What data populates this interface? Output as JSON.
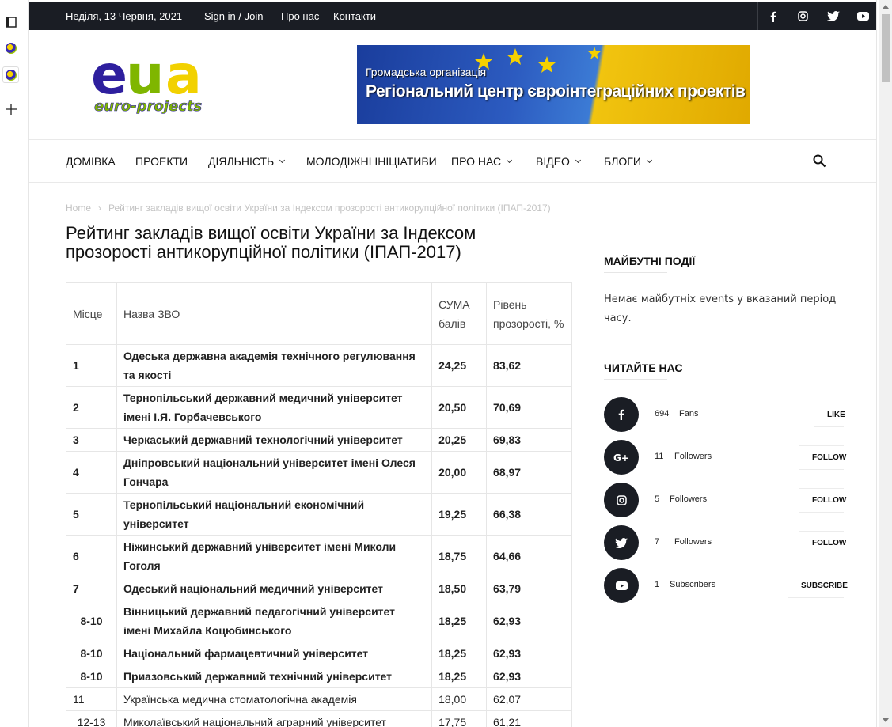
{
  "browser": {
    "scroll_up": "",
    "scroll_down": ""
  },
  "topbar": {
    "date": "Неділя, 13 Червня, 2021",
    "signin": "Sign in / Join",
    "about": "Про нас",
    "contacts": "Контакти"
  },
  "logo": {
    "text": "eua",
    "subtext": "euro-projects"
  },
  "banner": {
    "line1": "Громадська організація",
    "line2": "Регіональний центр євроінтеграційних проектів"
  },
  "nav": {
    "items": [
      {
        "label": "ДОМІВКА"
      },
      {
        "label": "ПРОЕКТИ"
      },
      {
        "label": "ДІЯЛЬНІСТЬ"
      },
      {
        "label": "МОЛОДІЖНІ ІНІЦІАТИВИ"
      },
      {
        "label": "ПРО НАС"
      },
      {
        "label": "ВІДЕО"
      },
      {
        "label": "БЛОГИ"
      }
    ]
  },
  "breadcrumb": {
    "home": "Home",
    "sep": "›",
    "current": "Рейтинг закладів вищої освіти України за Індексом прозорості антикорупційної політики (ІПАП-2017)"
  },
  "article": {
    "title": "Рейтинг закладів вищої освіти України за Індексом прозорості антикорупційної політики (ІПАП-2017)"
  },
  "table": {
    "headers": [
      "Місце",
      "Назва ЗВО",
      "СУМА балів",
      "Рівень прозорості, %"
    ],
    "rows": [
      {
        "place": "1",
        "name": "Одеська державна академія технічного регулювання та якості",
        "sum": "24,25",
        "level": "83,62"
      },
      {
        "place": "2",
        "name": "Тернопільський державний медичний університет імені І.Я. Горбачевського",
        "sum": "20,50",
        "level": "70,69"
      },
      {
        "place": "3",
        "name": "Черкаський державний технологічний університет",
        "sum": "20,25",
        "level": "69,83"
      },
      {
        "place": "4",
        "name": "Дніпровський національний університет імені Олеся Гончара",
        "sum": "20,00",
        "level": "68,97"
      },
      {
        "place": "5",
        "name": "Тернопільський національний економічний університет",
        "sum": "19,25",
        "level": "66,38"
      },
      {
        "place": "6",
        "name": "Ніжинський державний університет імені Миколи Гоголя",
        "sum": "18,75",
        "level": "64,66"
      },
      {
        "place": "7",
        "name": "Одеський національний медичний університет",
        "sum": "18,50",
        "level": "63,79"
      },
      {
        "place": "8-10",
        "name": "Вінницький державний педагогічний університет імені Михайла Коцюбинського",
        "sum": "18,25",
        "level": "62,93"
      },
      {
        "place": "8-10",
        "name": "Національний фармацевтичний університет",
        "sum": "18,25",
        "level": "62,93"
      },
      {
        "place": "8-10",
        "name": "Приазовський державний технічний університет",
        "sum": "18,25",
        "level": "62,93"
      },
      {
        "place": "11",
        "name": "Українська медична стоматологічна академія",
        "sum": "18,00",
        "level": "62,07"
      },
      {
        "place": "12-13",
        "name": "Миколаївський національний аграрний університет",
        "sum": "17,75",
        "level": "61,21"
      }
    ]
  },
  "sidebar": {
    "events_title": "МАЙБУТНІ ПОДІЇ",
    "events_text": "Немає майбутніх events у вказаний період часу.",
    "follow_title": "ЧИТАЙТЕ НАС",
    "social": [
      {
        "icon": "facebook-icon",
        "count": "694",
        "label": "Fans",
        "button": "LIKE"
      },
      {
        "icon": "google-plus-icon",
        "count": "11",
        "label": "Followers",
        "button": "FOLLOW"
      },
      {
        "icon": "instagram-icon",
        "count": "5",
        "label": "Followers",
        "button": "FOLLOW"
      },
      {
        "icon": "twitter-icon",
        "count": "7",
        "label": "Followers",
        "button": "FOLLOW"
      },
      {
        "icon": "youtube-icon",
        "count": "1",
        "label": "Subscribers",
        "button": "SUBSCRIBE"
      }
    ]
  },
  "colors": {
    "topbar_bg": "#1a1d24",
    "text": "#222222",
    "muted": "#c3c3c3"
  }
}
